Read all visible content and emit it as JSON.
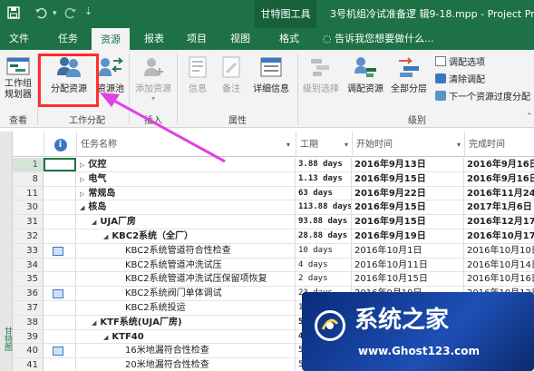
{
  "titlebar": {
    "contextual_tab": "甘特图工具",
    "document_title": "3号机组冷试准备逻 辑9-18.mpp - Project Pro",
    "save_icon": "save-icon",
    "undo_icon": "undo-icon",
    "redo_icon": "redo-icon"
  },
  "tabs": [
    "文件",
    "任务",
    "资源",
    "报表",
    "项目",
    "视图",
    "格式"
  ],
  "active_tab": "资源",
  "tell_me": "告诉我您想要做什么...",
  "ribbon": {
    "team_planner": "工作组规划器",
    "assign_resources": "分配资源",
    "resource_pool": "资源池",
    "add_resources": "添加资源",
    "information": "信息",
    "notes": "备注",
    "details": "详细信息",
    "level_selection": "级别选择",
    "level_resource": "调配资源",
    "level_all": "全部分层",
    "leveling_options": "调配选项",
    "clear_leveling": "清除调配",
    "next_overallocation": "下一个资源过度分配",
    "group_view": "查看",
    "group_assignments": "工作分配",
    "group_insert": "插入",
    "group_properties": "属性",
    "group_level": "级别"
  },
  "grid": {
    "headers": {
      "info": "i",
      "task_name": "任务名称",
      "duration": "工期",
      "start": "开始时间",
      "finish": "完成时间"
    },
    "side_label": "甘特图",
    "rows": [
      {
        "id": "1",
        "name": "仪控",
        "indent": 0,
        "expand": "▷",
        "duration": "3.88 days",
        "start": "2016年9月13日",
        "finish": "2016年9月16日",
        "bold": true,
        "selected": true,
        "icon": false
      },
      {
        "id": "8",
        "name": "电气",
        "indent": 0,
        "expand": "▷",
        "duration": "1.13 days",
        "start": "2016年9月15日",
        "finish": "2016年9月16日",
        "bold": true,
        "icon": false
      },
      {
        "id": "11",
        "name": "常规岛",
        "indent": 0,
        "expand": "▷",
        "duration": "63 days",
        "start": "2016年9月22日",
        "finish": "2016年11月24日",
        "bold": true,
        "icon": false
      },
      {
        "id": "30",
        "name": "核岛",
        "indent": 0,
        "expand": "◢",
        "duration": "113.88 days",
        "start": "2016年9月15日",
        "finish": "2017年1月6日",
        "bold": true,
        "icon": false
      },
      {
        "id": "31",
        "name": "UJA厂房",
        "indent": 1,
        "expand": "◢",
        "duration": "93.88 days",
        "start": "2016年9月15日",
        "finish": "2016年12月17日",
        "bold": true,
        "icon": false
      },
      {
        "id": "32",
        "name": "KBC2系统（全厂）",
        "indent": 2,
        "expand": "◢",
        "duration": "28.88 days",
        "start": "2016年9月19日",
        "finish": "2016年10月17日",
        "bold": true,
        "icon": false
      },
      {
        "id": "33",
        "name": "KBC2系统管道符合性检查",
        "indent": 3,
        "expand": "",
        "duration": "10 days",
        "start": "2016年10月1日",
        "finish": "2016年10月10日",
        "bold": false,
        "icon": true
      },
      {
        "id": "34",
        "name": "KBC2系统管道冲洗试压",
        "indent": 3,
        "expand": "",
        "duration": "4 days",
        "start": "2016年10月11日",
        "finish": "2016年10月14日",
        "bold": false,
        "icon": false
      },
      {
        "id": "35",
        "name": "KBC2系统管道冲洗试压保留项恢复",
        "indent": 3,
        "expand": "",
        "duration": "2 days",
        "start": "2016年10月15日",
        "finish": "2016年10月16日",
        "bold": false,
        "icon": false
      },
      {
        "id": "36",
        "name": "KBC2系统阀门单体调试",
        "indent": 3,
        "expand": "",
        "duration": "23 days",
        "start": "2016年9月19日",
        "finish": "2016年10月12日",
        "bold": false,
        "icon": true
      },
      {
        "id": "37",
        "name": "KBC2系统投运",
        "indent": 3,
        "expand": "",
        "duration": "1",
        "start": "",
        "finish": "",
        "bold": false,
        "icon": false
      },
      {
        "id": "38",
        "name": "KTF系统(UJA厂房)",
        "indent": 1,
        "expand": "◢",
        "duration": "51",
        "start": "",
        "finish": "",
        "bold": true,
        "icon": false
      },
      {
        "id": "39",
        "name": "KTF40",
        "indent": 2,
        "expand": "◢",
        "duration": "48",
        "start": "",
        "finish": "",
        "bold": true,
        "icon": false
      },
      {
        "id": "40",
        "name": "16米地漏符合性检查",
        "indent": 3,
        "expand": "",
        "duration": "5",
        "start": "",
        "finish": "",
        "bold": false,
        "icon": true
      },
      {
        "id": "41",
        "name": "20米地漏符合性检查",
        "indent": 3,
        "expand": "",
        "duration": "5",
        "start": "",
        "finish": "",
        "bold": false,
        "icon": false
      }
    ]
  },
  "watermark": {
    "title": "系统之家",
    "url": "www.Ghost123.com"
  },
  "colors": {
    "title_bar": "#1e7145",
    "ribbon": "#f3f3f3",
    "highlight": "#ff2d2d",
    "arrow": "#e040e8"
  }
}
